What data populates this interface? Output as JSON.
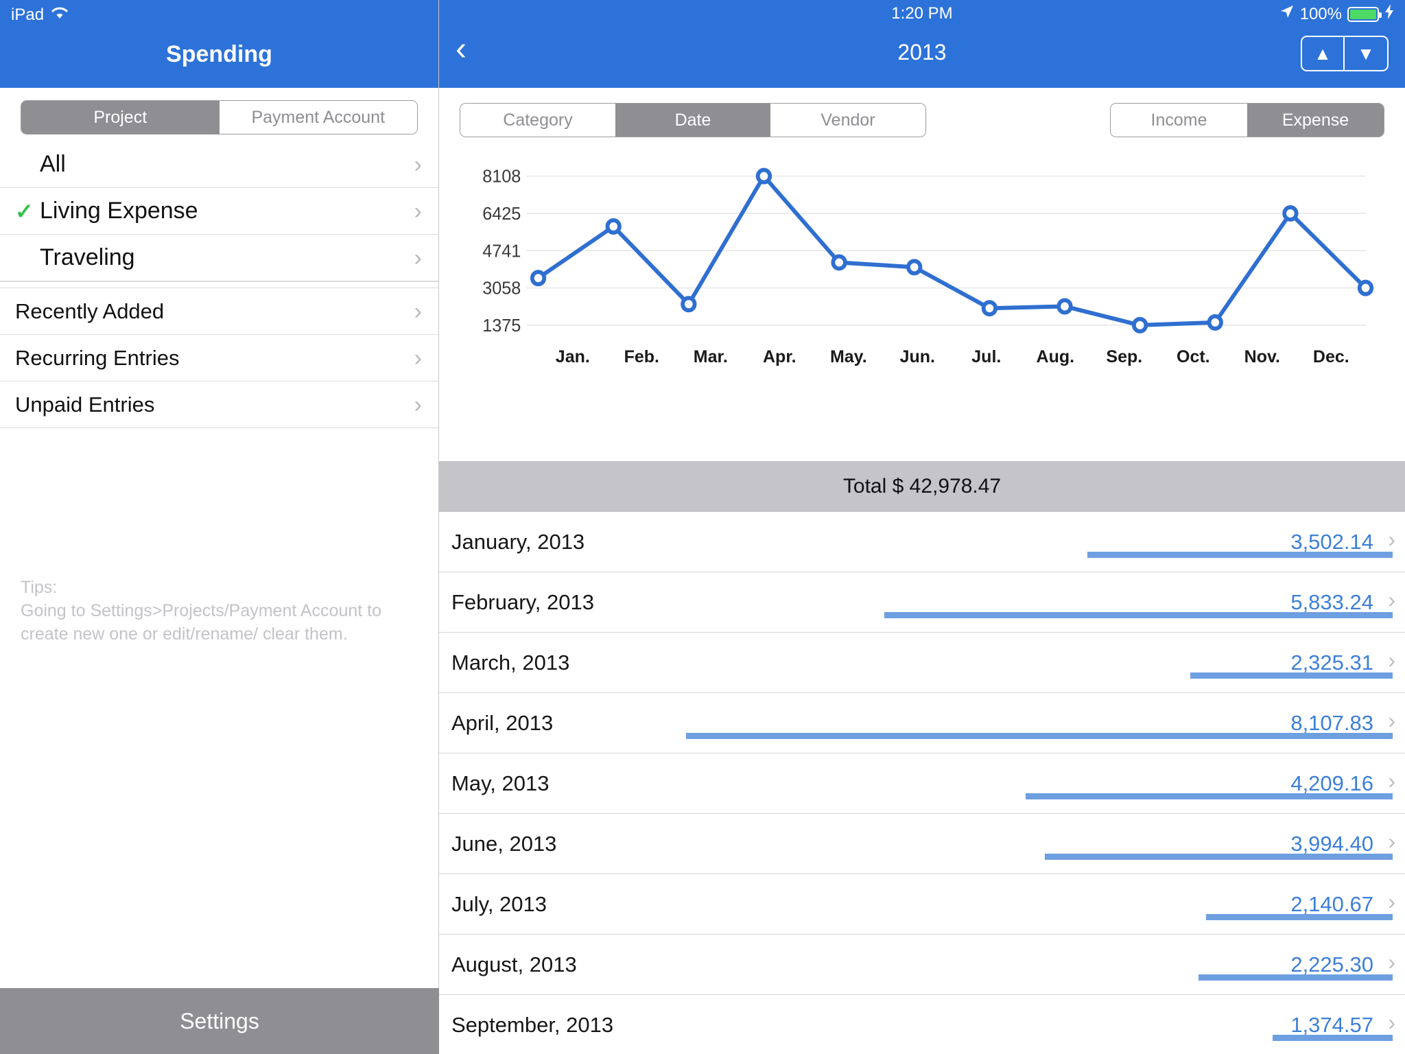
{
  "status_bar": {
    "device": "iPad",
    "wifi_icon": "wifi-icon",
    "time": "1:20 PM",
    "location_icon": "location-arrow-icon",
    "battery_percent": "100%",
    "battery_icon": "battery-icon",
    "charging_icon": "lightning-bolt-icon"
  },
  "sidebar": {
    "title": "Spending",
    "scope_segments": [
      {
        "label": "Project",
        "selected": true
      },
      {
        "label": "Payment Account",
        "selected": false
      }
    ],
    "projects": [
      {
        "label": "All",
        "checked": false
      },
      {
        "label": "Living Expense",
        "checked": true
      },
      {
        "label": "Traveling",
        "checked": false
      }
    ],
    "links": [
      {
        "label": "Recently Added"
      },
      {
        "label": "Recurring Entries"
      },
      {
        "label": "Unpaid Entries"
      }
    ],
    "tips": {
      "heading": "Tips:",
      "body": "Going to Settings>Projects/Payment Account to create new one or edit/rename/ clear them."
    },
    "settings_label": "Settings",
    "chevron_icon": "chevron-right-icon",
    "check_icon": "checkmark-icon"
  },
  "detail": {
    "back_icon": "chevron-left-icon",
    "title": "2013",
    "stepper": [
      {
        "label": "▲",
        "icon": "triangle-up-icon"
      },
      {
        "label": "▼",
        "icon": "triangle-down-icon"
      }
    ],
    "group_segments": [
      {
        "label": "Category",
        "selected": false
      },
      {
        "label": "Date",
        "selected": true
      },
      {
        "label": "Vendor",
        "selected": false
      }
    ],
    "flow_segments": [
      {
        "label": "Income",
        "selected": false
      },
      {
        "label": "Expense",
        "selected": true
      }
    ],
    "total_label": "Total $ 42,978.47",
    "rows": [
      {
        "month": "January, 2013",
        "value": "3,502.14",
        "amount": 3502.14
      },
      {
        "month": "February, 2013",
        "value": "5,833.24",
        "amount": 5833.24
      },
      {
        "month": "March, 2013",
        "value": "2,325.31",
        "amount": 2325.31
      },
      {
        "month": "April, 2013",
        "value": "8,107.83",
        "amount": 8107.83
      },
      {
        "month": "May, 2013",
        "value": "4,209.16",
        "amount": 4209.16
      },
      {
        "month": "June, 2013",
        "value": "3,994.40",
        "amount": 3994.4
      },
      {
        "month": "July, 2013",
        "value": "2,140.67",
        "amount": 2140.67
      },
      {
        "month": "August, 2013",
        "value": "2,225.30",
        "amount": 2225.3
      },
      {
        "month": "September, 2013",
        "value": "1,374.57",
        "amount": 1374.57
      }
    ],
    "row_chevron_icon": "chevron-right-icon"
  },
  "colors": {
    "brand_blue": "#2d72d9",
    "line_blue": "#2f6fd0",
    "bar_blue": "#6e9fe0",
    "value_blue": "#3d7fd6",
    "segment_gray": "#8e8e93",
    "total_gray": "#c4c4c9",
    "check_green": "#35c14a"
  },
  "chart_data": {
    "type": "line",
    "title": "",
    "xlabel": "",
    "ylabel": "",
    "categories": [
      "Jan.",
      "Feb.",
      "Mar.",
      "Apr.",
      "May.",
      "Jun.",
      "Jul.",
      "Aug.",
      "Sep.",
      "Oct.",
      "Nov.",
      "Dec."
    ],
    "values": [
      3502.14,
      5833.24,
      2325.31,
      8107.83,
      4209.16,
      3994.4,
      2140.67,
      2225.3,
      1374.57,
      1500.0,
      6425.0,
      3058.0
    ],
    "ytick_labels": [
      "8108",
      "6425",
      "4741",
      "3058",
      "1375"
    ],
    "yticks": [
      8108,
      6425,
      4741,
      3058,
      1375
    ],
    "ylim": [
      1000,
      8500
    ],
    "grid": true,
    "legend": false,
    "marker": "circle"
  }
}
